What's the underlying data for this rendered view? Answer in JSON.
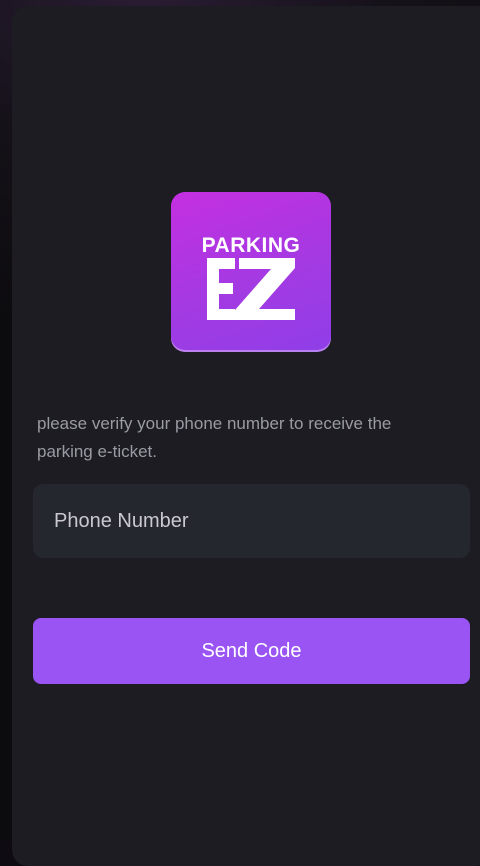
{
  "app": {
    "logo": {
      "top_text": "PARKING",
      "mark_text": "EZ",
      "color_start": "#c42fe1",
      "color_end": "#8f3ee8"
    }
  },
  "verify": {
    "instruction": "please verify your phone number to receive the parking e-ticket.",
    "phone_placeholder": "Phone Number",
    "phone_value": "",
    "send_label": "Send Code"
  },
  "colors": {
    "background": "#1c1c22",
    "input_background": "#25272f",
    "accent": "#9a54f3"
  }
}
